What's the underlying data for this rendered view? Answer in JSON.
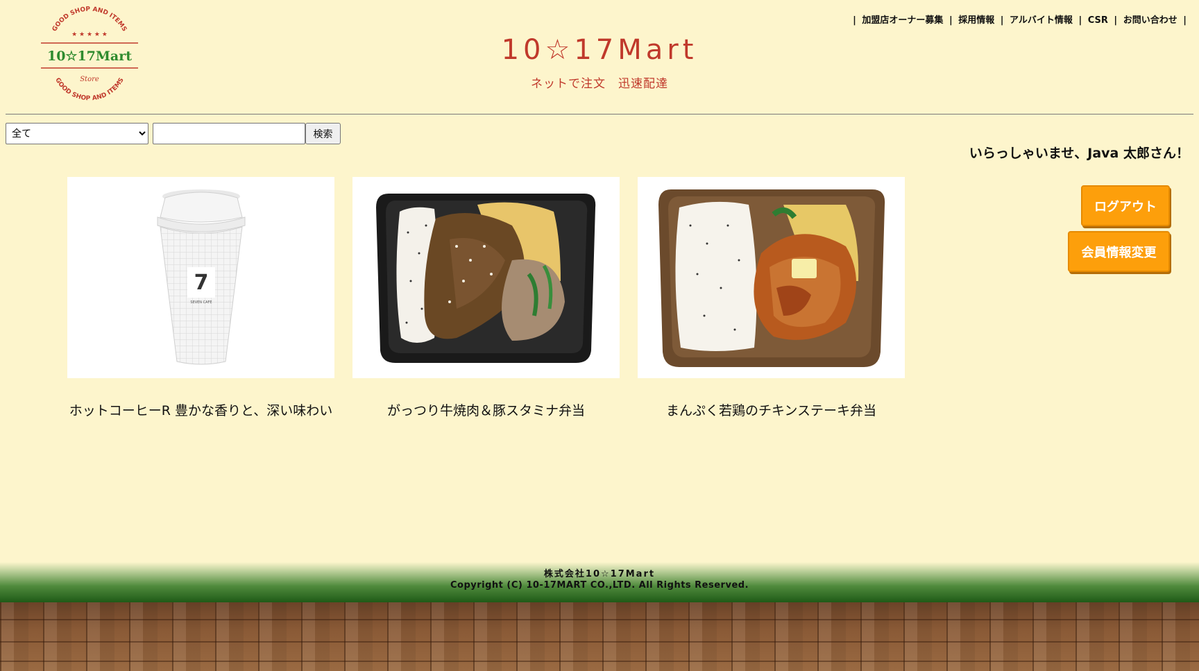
{
  "logo": {
    "top_arc": "GOOD SHOP AND ITEMS",
    "stars": "★ ★ ★ ★ ★",
    "name": "10☆17Mart",
    "tagline": "Store",
    "bottom_arc": "GOOD SHOP AND ITEMS"
  },
  "nav": {
    "items": [
      "加盟店オーナー募集",
      "採用情報",
      "アルバイト情報",
      "CSR",
      "お問い合わせ"
    ],
    "separator": "|"
  },
  "header": {
    "title": "10☆17Mart",
    "subtitle": "ネットで注文　迅速配達"
  },
  "search": {
    "category_selected": "全て",
    "query_value": "",
    "button_label": "検索"
  },
  "welcome": {
    "message": "いらっしゃいませ、Java 太郎さん！"
  },
  "actions": {
    "logout_label": "ログアウト",
    "member_label": "会員情報変更"
  },
  "products": [
    {
      "name": "ホットコーヒーR 豊かな香りと、深い味わい",
      "image": "coffee-cup"
    },
    {
      "name": "がっつり牛焼肉＆豚スタミナ弁当",
      "image": "beef-bento"
    },
    {
      "name": "まんぷく若鶏のチキンステーキ弁当",
      "image": "chicken-bento"
    }
  ],
  "footer": {
    "company": "株式会社10☆17Mart",
    "copyright": "Copyright (C) 10-17MART CO.,LTD. All Rights Reserved."
  },
  "colors": {
    "background": "#fdf5cc",
    "title_red": "#c0392b",
    "button_orange": "#fd9f0b",
    "footer_green": "#1f5a17"
  }
}
